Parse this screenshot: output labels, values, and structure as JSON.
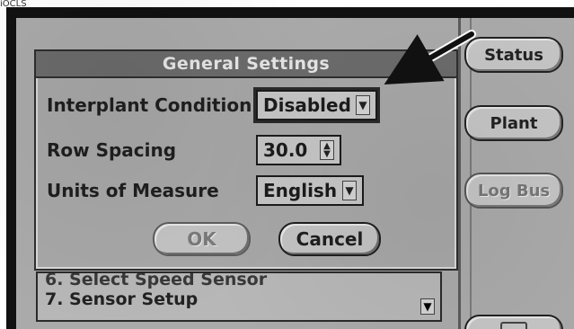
{
  "top_fragment": "iOCLS",
  "sidebar": {
    "buttons": [
      {
        "label": "Status",
        "enabled": true
      },
      {
        "label": "Plant",
        "enabled": true
      },
      {
        "label": "Log Bus",
        "enabled": false
      }
    ]
  },
  "dialog": {
    "title": "General Settings",
    "rows": [
      {
        "label": "Interplant Condition",
        "value": "Disabled",
        "control": "dropdown",
        "highlighted": true
      },
      {
        "label": "Row Spacing",
        "value": "30.0",
        "control": "spinner",
        "highlighted": false
      },
      {
        "label": "Units of Measure",
        "value": "English",
        "control": "dropdown",
        "highlighted": false
      }
    ],
    "buttons": {
      "ok_label": "OK",
      "cancel_label": "Cancel",
      "ok_enabled": false
    }
  },
  "list": {
    "items": [
      "6. Select Speed Sensor",
      "7. Sensor Setup"
    ]
  },
  "colors": {
    "screen_bg": "#aaaaaa",
    "dialog_title_bg": "#6b6b6b",
    "dialog_bg": "#a7a7a7",
    "text_dark": "#1f1f1f",
    "disabled_text": "#7a7a7a",
    "bezel": "#111111"
  },
  "icons": {
    "annotation_arrow": "arrow-pointing-to-field",
    "dropdown_caret": "chevron-down",
    "spinner": "up-down-stepper",
    "scroll_down": "arrow-down"
  }
}
